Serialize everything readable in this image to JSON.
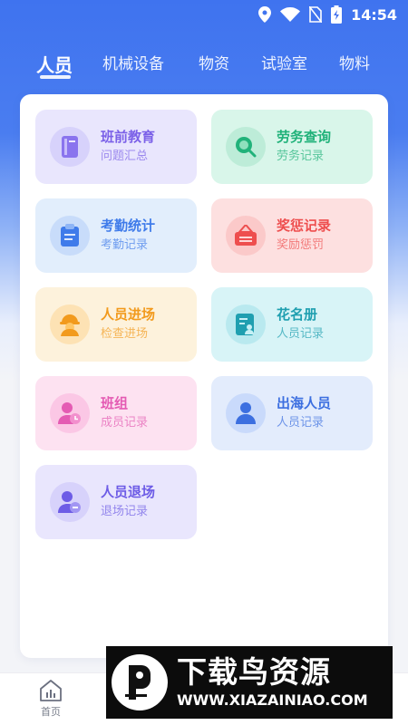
{
  "status_bar": {
    "time": "14:54"
  },
  "tabs": [
    {
      "label": "人员",
      "active": true
    },
    {
      "label": "机械设备",
      "active": false
    },
    {
      "label": "物资",
      "active": false
    },
    {
      "label": "试验室",
      "active": false
    },
    {
      "label": "物料",
      "active": false
    }
  ],
  "cards": [
    {
      "title": "班前教育",
      "subtitle": "问题汇总",
      "icon": "book-icon",
      "title_color": "#7b61e8",
      "bg": "#e9e6fd"
    },
    {
      "title": "劳务查询",
      "subtitle": "劳务记录",
      "icon": "search-icon",
      "title_color": "#21b27a",
      "bg": "#d9f6ea"
    },
    {
      "title": "考勤统计",
      "subtitle": "考勤记录",
      "icon": "clipboard-icon",
      "title_color": "#3f7bea",
      "bg": "#e2eefc"
    },
    {
      "title": "奖惩记录",
      "subtitle": "奖励惩罚",
      "icon": "sign-board-icon",
      "title_color": "#ee4e4e",
      "bg": "#fde0e0"
    },
    {
      "title": "人员进场",
      "subtitle": "检查进场",
      "icon": "worker-helmet-icon",
      "title_color": "#f29a1c",
      "bg": "#fdf2dc"
    },
    {
      "title": "花名册",
      "subtitle": "人员记录",
      "icon": "roster-icon",
      "title_color": "#1f9fb0",
      "bg": "#d8f4f7"
    },
    {
      "title": "班组",
      "subtitle": "成员记录",
      "icon": "user-clock-icon",
      "title_color": "#e45bb3",
      "bg": "#fde2f1"
    },
    {
      "title": "出海人员",
      "subtitle": "人员记录",
      "icon": "user-icon",
      "title_color": "#3c6fe0",
      "bg": "#e3ecfc"
    },
    {
      "title": "人员退场",
      "subtitle": "退场记录",
      "icon": "user-exit-icon",
      "title_color": "#6d5ce6",
      "bg": "#e9e6fd"
    }
  ],
  "bottom_nav": {
    "home_label": "首页"
  },
  "watermark": {
    "title": "下载鸟资源",
    "url": "WWW.XIAZAINIAO.COM"
  }
}
